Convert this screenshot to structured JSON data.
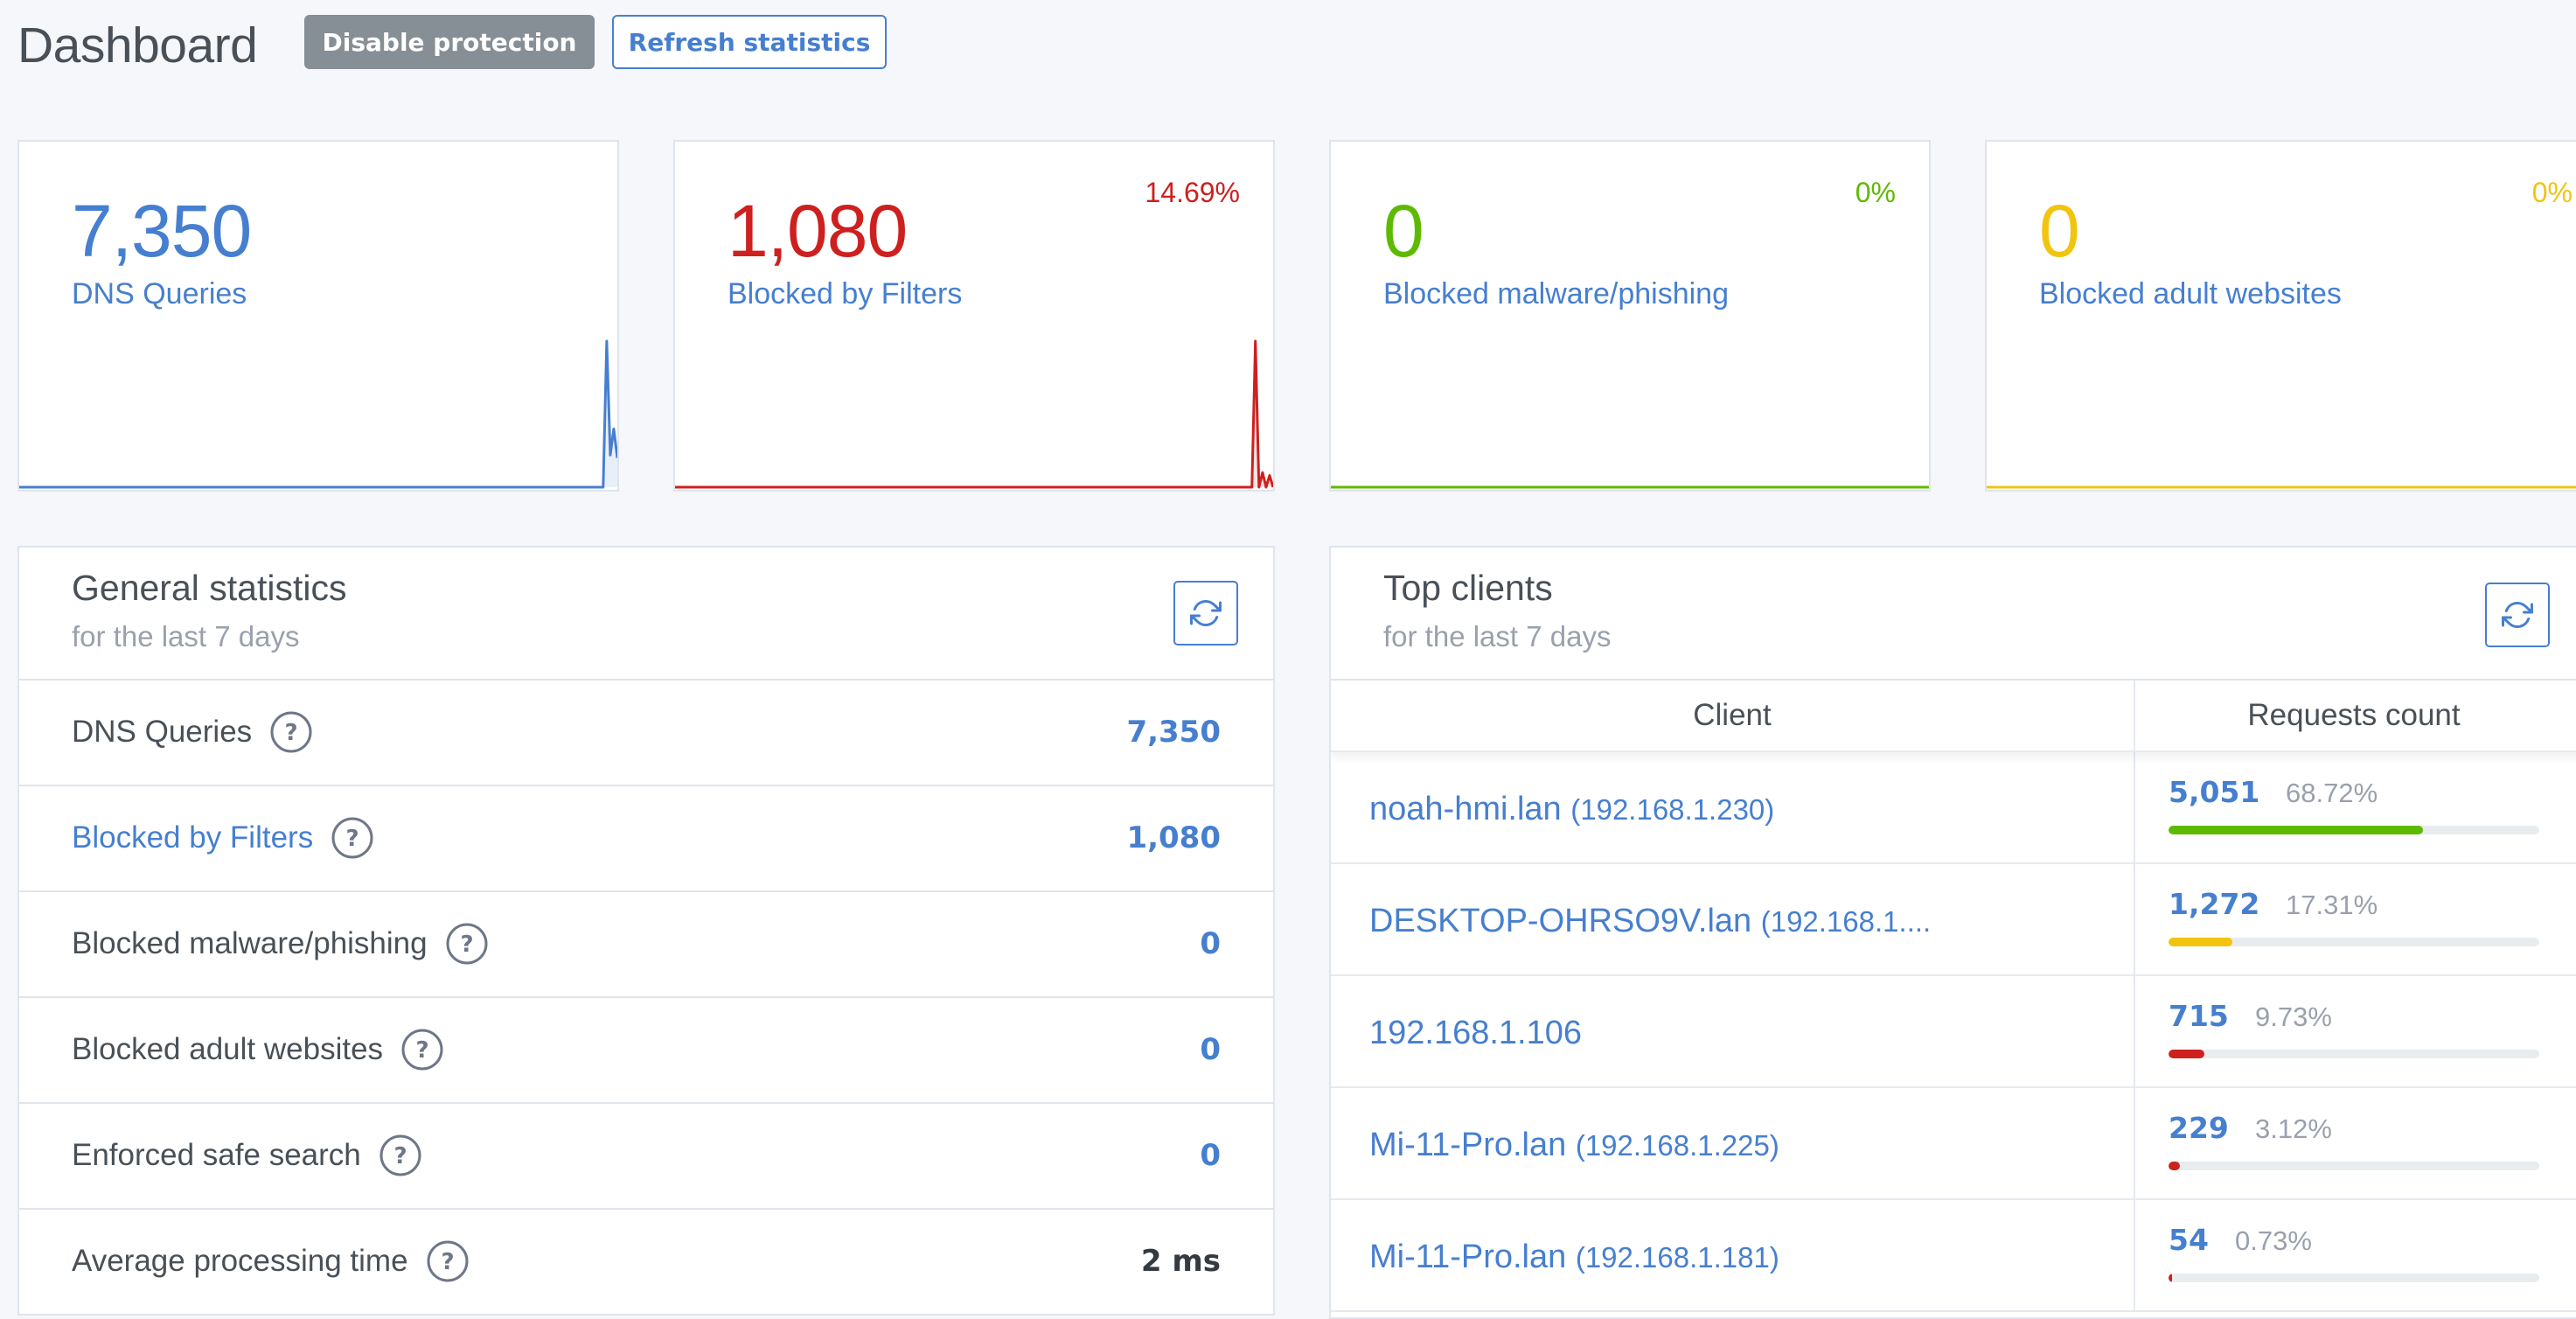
{
  "header": {
    "title": "Dashboard",
    "disable_protection_label": "Disable protection",
    "refresh_statistics_label": "Refresh statistics"
  },
  "cards": [
    {
      "value": "7,350",
      "label": "DNS Queries",
      "percent": "",
      "color": "#467fcf",
      "series": [
        0,
        0,
        0,
        0,
        0,
        0,
        0,
        0,
        0,
        0,
        0,
        0,
        0,
        0,
        0,
        0,
        0,
        0,
        0,
        0,
        0,
        0,
        0,
        0,
        0,
        0,
        0,
        0,
        0,
        0,
        0,
        0,
        0,
        0,
        0,
        0,
        0,
        0,
        0,
        0,
        0,
        0,
        0,
        0,
        0,
        0,
        0,
        0,
        0,
        0,
        0,
        0,
        0,
        0,
        0,
        0,
        0,
        0,
        0,
        0,
        0,
        0,
        0,
        0,
        0,
        0,
        0,
        0,
        0,
        0,
        0,
        0,
        0,
        0,
        0,
        0,
        0,
        0,
        0,
        0,
        0,
        0,
        0,
        0,
        0,
        0,
        0,
        0,
        0,
        0,
        0,
        0,
        0,
        0,
        0,
        0,
        0,
        0,
        0,
        0,
        0,
        0,
        0,
        0,
        0,
        0,
        0,
        0,
        0,
        0,
        0,
        0,
        0,
        0,
        0,
        0,
        0,
        0,
        0,
        0,
        0,
        0,
        0,
        0,
        0,
        0,
        0,
        0,
        0,
        0,
        0,
        0,
        0,
        0,
        0,
        0,
        0,
        0,
        0,
        0,
        0,
        0,
        0,
        0,
        0,
        0,
        0,
        0,
        0,
        0,
        0,
        0,
        0,
        0,
        0,
        0,
        0,
        0,
        0,
        0,
        0,
        0,
        0,
        0,
        0,
        0,
        100,
        22,
        40,
        20
      ]
    },
    {
      "value": "1,080",
      "label": "Blocked by Filters",
      "percent": "14.69%",
      "color": "#cd201f",
      "series": [
        0,
        0,
        0,
        0,
        0,
        0,
        0,
        0,
        0,
        0,
        0,
        0,
        0,
        0,
        0,
        0,
        0,
        0,
        0,
        0,
        0,
        0,
        0,
        0,
        0,
        0,
        0,
        0,
        0,
        0,
        0,
        0,
        0,
        0,
        0,
        0,
        0,
        0,
        0,
        0,
        0,
        0,
        0,
        0,
        0,
        0,
        0,
        0,
        0,
        0,
        0,
        0,
        0,
        0,
        0,
        0,
        0,
        0,
        0,
        0,
        0,
        0,
        0,
        0,
        0,
        0,
        0,
        0,
        0,
        0,
        0,
        0,
        0,
        0,
        0,
        0,
        0,
        0,
        0,
        0,
        0,
        0,
        0,
        0,
        0,
        0,
        0,
        0,
        0,
        0,
        0,
        0,
        0,
        0,
        0,
        0,
        0,
        0,
        0,
        0,
        0,
        0,
        0,
        0,
        0,
        0,
        0,
        0,
        0,
        0,
        0,
        0,
        0,
        0,
        0,
        0,
        0,
        0,
        0,
        0,
        0,
        0,
        0,
        0,
        0,
        0,
        0,
        0,
        0,
        0,
        0,
        0,
        0,
        0,
        0,
        0,
        0,
        0,
        0,
        0,
        0,
        0,
        0,
        0,
        0,
        0,
        0,
        0,
        0,
        0,
        0,
        0,
        0,
        0,
        0,
        0,
        0,
        0,
        0,
        0,
        0,
        0,
        0,
        0,
        100,
        0,
        10,
        0,
        8,
        0
      ]
    },
    {
      "value": "0",
      "label": "Blocked malware/phishing",
      "percent": "0%",
      "color": "#5eba00",
      "series": [
        0,
        0
      ]
    },
    {
      "value": "0",
      "label": "Blocked adult websites",
      "percent": "0%",
      "color": "#f1c40f",
      "series": [
        0,
        0
      ]
    }
  ],
  "general_stats": {
    "title": "General statistics",
    "subtitle": "for the last 7 days",
    "rows": [
      {
        "label": "DNS Queries",
        "value": "7,350"
      },
      {
        "label": "Blocked by Filters",
        "value": "1,080"
      },
      {
        "label": "Blocked malware/phishing",
        "value": "0"
      },
      {
        "label": "Blocked adult websites",
        "value": "0"
      },
      {
        "label": "Enforced safe search",
        "value": "0"
      },
      {
        "label": "Average processing time",
        "value": "2 ms"
      }
    ]
  },
  "top_clients": {
    "title": "Top clients",
    "subtitle": "for the last 7 days",
    "columns": [
      "Client",
      "Requests count"
    ],
    "rows": [
      {
        "name": "noah-hmi.lan",
        "ip": "(192.168.1.230)",
        "count": "5,051",
        "percent": "68.72%",
        "fraction": 0.6872,
        "bar_color": "#5eba00"
      },
      {
        "name": "DESKTOP-OHRSO9V.lan",
        "ip": "(192.168.1....",
        "count": "1,272",
        "percent": "17.31%",
        "fraction": 0.1731,
        "bar_color": "#f1c40f"
      },
      {
        "name": "192.168.1.106",
        "ip": "",
        "count": "715",
        "percent": "9.73%",
        "fraction": 0.0973,
        "bar_color": "#cd201f"
      },
      {
        "name": "Mi-11-Pro.lan",
        "ip": "(192.168.1.225)",
        "count": "229",
        "percent": "3.12%",
        "fraction": 0.0312,
        "bar_color": "#cd201f"
      },
      {
        "name": "Mi-11-Pro.lan",
        "ip": "(192.168.1.181)",
        "count": "54",
        "percent": "0.73%",
        "fraction": 0.0073,
        "bar_color": "#cd201f"
      }
    ]
  }
}
